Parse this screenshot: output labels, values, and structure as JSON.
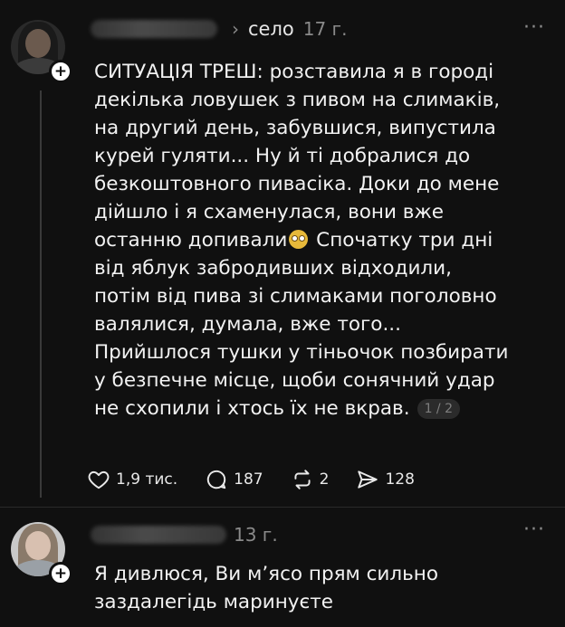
{
  "post": {
    "community": "село",
    "time": "17 г.",
    "more": "···",
    "text_line_1": "СИТУАЦІЯ ТРЕШ: розставила я в городі",
    "text_line_2": "декілька ловушек з пивом на слимаків,",
    "text_line_3": "на другий день, забувшися, випустила",
    "text_line_4": "курей гуляти... Ну й ті добралися до",
    "text_line_5": "безкоштовного пивасіка. Доки до мене",
    "text_line_6": "дійшло і я схаменулася, вони вже",
    "text_line_7a": "останню допивали",
    "text_line_7b": " Спочатку три дні",
    "text_line_8": "від яблук забродивших відходили,",
    "text_line_9": "потім від пива зі слимаками поголовно",
    "text_line_10": "валялися, думала, вже того...",
    "text_line_11": "Прийшлося тушки у тіньочок позбирати",
    "text_line_12": "у безпечне місце, щоби сонячний удар",
    "text_line_13": "не схопили і хтось їх не вкрав.",
    "page_indicator": "1 / 2",
    "emoji": "flushed-face-emoji",
    "likes": "1,9 тис.",
    "comments": "187",
    "reposts": "2",
    "shares": "128"
  },
  "reply": {
    "time": "13 г.",
    "more": "···",
    "text_line_1": "Я дивлюся, Ви м’ясо прям сильно",
    "text_line_2": "заздалегідь маринуєте"
  },
  "colors": {
    "background": "#101010",
    "text": "#f2f2f2",
    "muted": "#8a8a8a"
  }
}
